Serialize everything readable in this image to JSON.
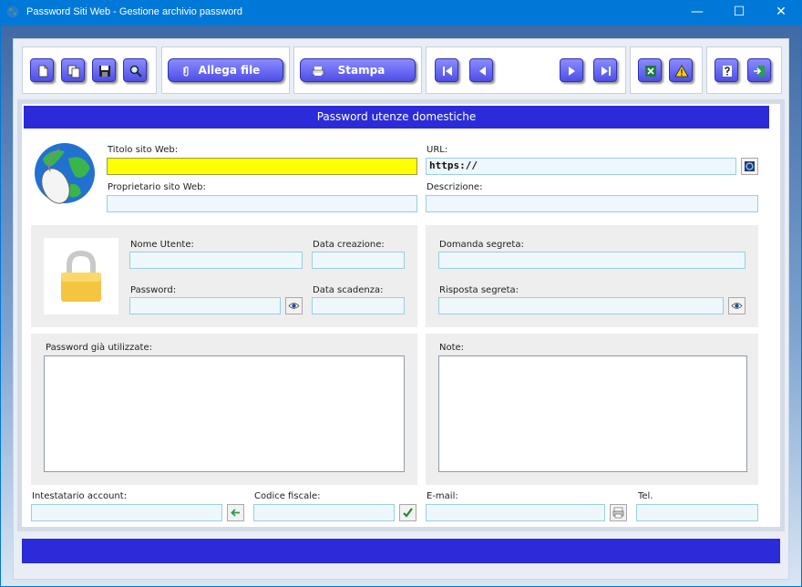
{
  "window": {
    "title": "Password Siti Web - Gestione archivio password",
    "minimize_glyph": "—",
    "maximize_glyph": "☐",
    "close_glyph": "✕"
  },
  "toolbar": {
    "attach_label": "Allega file",
    "print_label": "Stampa"
  },
  "icons": {
    "new": "new-document-icon",
    "duplicate": "copy-icon",
    "save": "floppy-save-icon",
    "search": "magnifier-icon",
    "attach": "paperclip-icon",
    "print": "printer-icon",
    "first": "first-record-icon",
    "prev": "previous-record-icon",
    "next": "next-record-icon",
    "last": "last-record-icon",
    "excel": "excel-export-icon",
    "warning": "warning-icon",
    "help": "help-icon",
    "exit": "exit-door-icon"
  },
  "colors": {
    "accent": "#2b2bd9",
    "button": "#5a5cf0",
    "highlight_field": "#ffff00",
    "field_bg": "#eef7fb",
    "field_border": "#99cfe0"
  },
  "form": {
    "header": "Password utenze domestiche",
    "site_title_label": "Titolo sito Web:",
    "site_title_value": "",
    "url_label": "URL:",
    "url_value": "https://",
    "owner_label": "Proprietario sito Web:",
    "owner_value": "",
    "description_label": "Descrizione:",
    "description_value": "",
    "username_label": "Nome Utente:",
    "username_value": "",
    "created_label": "Data creazione:",
    "created_value": "",
    "password_label": "Password:",
    "password_value": "",
    "expiry_label": "Data scadenza:",
    "expiry_value": "",
    "secret_question_label": "Domanda segreta:",
    "secret_question_value": "",
    "secret_answer_label": "Risposta segreta:",
    "secret_answer_value": "",
    "used_passwords_label": "Password già utilizzate:",
    "notes_label": "Note:",
    "account_holder_label": "Intestatario account:",
    "account_holder_value": "",
    "tax_code_label": "Codice fiscale:",
    "tax_code_value": "",
    "email_label": "E-mail:",
    "email_value": "",
    "phone_label": "Tel.",
    "phone_value": ""
  }
}
